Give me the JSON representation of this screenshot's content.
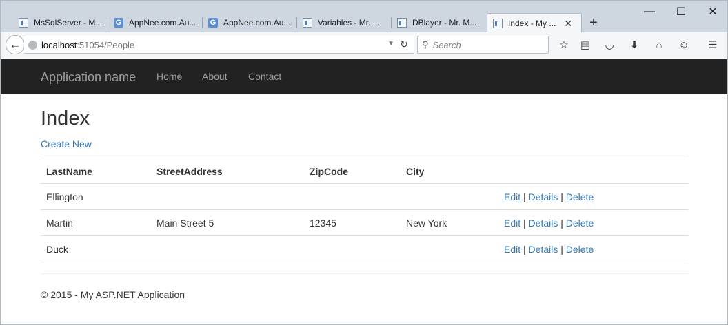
{
  "browser": {
    "tabs": [
      {
        "label": "MsSqlServer - M...",
        "icon": "document-icon"
      },
      {
        "label": "AppNee.com.Au...",
        "icon": "g-icon"
      },
      {
        "label": "AppNee.com.Au...",
        "icon": "g-icon"
      },
      {
        "label": "Variables - Mr. ...",
        "icon": "document-icon"
      },
      {
        "label": "DBlayer - Mr. M...",
        "icon": "document-icon"
      },
      {
        "label": "Index - My ...",
        "icon": "document-icon",
        "active": true
      }
    ],
    "new_tab": "+",
    "window": {
      "minimize": "—",
      "maximize": "☐",
      "close": "✕"
    },
    "url": {
      "host": "localhost",
      "path": ":51054/People"
    },
    "search_placeholder": "Search",
    "toolbar_icons": [
      "bookmark-star-icon",
      "reading-list-icon",
      "pocket-icon",
      "download-icon",
      "home-icon",
      "smiley-icon",
      "menu-icon"
    ]
  },
  "app": {
    "brand": "Application name",
    "nav": [
      "Home",
      "About",
      "Contact"
    ]
  },
  "main": {
    "title": "Index",
    "create_new": "Create New",
    "columns": [
      "LastName",
      "StreetAddress",
      "ZipCode",
      "City"
    ],
    "rows": [
      {
        "last_name": "Ellington",
        "street": "",
        "zip": "",
        "city": ""
      },
      {
        "last_name": "Martin",
        "street": "Main Street 5",
        "zip": "12345",
        "city": "New York"
      },
      {
        "last_name": "Duck",
        "street": "",
        "zip": "",
        "city": ""
      }
    ],
    "actions": {
      "edit": "Edit",
      "details": "Details",
      "delete": "Delete",
      "sep": "|"
    }
  },
  "footer": "© 2015 - My ASP.NET Application"
}
